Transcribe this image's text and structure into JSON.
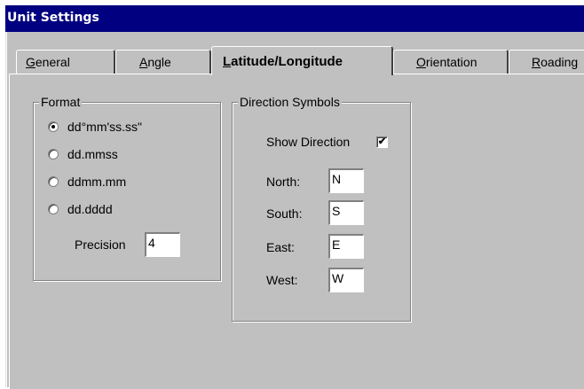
{
  "window": {
    "title": "Unit Settings"
  },
  "tabs": [
    {
      "label_pre": "",
      "mnemonic": "G",
      "label_post": "eneral"
    },
    {
      "label_pre": "",
      "mnemonic": "A",
      "label_post": "ngle"
    },
    {
      "label_pre": "",
      "mnemonic": "L",
      "label_post": "atitude/Longitude"
    },
    {
      "label_pre": "",
      "mnemonic": "O",
      "label_post": "rientation"
    },
    {
      "label_pre": "",
      "mnemonic": "R",
      "label_post": "oading"
    }
  ],
  "active_tab": "Latitude/Longitude",
  "format_group": {
    "title": "Format",
    "options": [
      {
        "label": "dd°mm'ss.ss\"",
        "selected": true
      },
      {
        "label": "dd.mmss",
        "selected": false
      },
      {
        "label": "ddmm.mm",
        "selected": false
      },
      {
        "label": "dd.dddd",
        "selected": false
      }
    ],
    "precision_label": "Precision",
    "precision_value": "4"
  },
  "direction_group": {
    "title": "Direction Symbols",
    "show_direction_label": "Show Direction",
    "show_direction_checked": true,
    "check_mark": "✔",
    "fields": [
      {
        "label": "North:",
        "value": "N"
      },
      {
        "label": "South:",
        "value": "S"
      },
      {
        "label": "East:",
        "value": "E"
      },
      {
        "label": "West:",
        "value": "W"
      }
    ]
  }
}
